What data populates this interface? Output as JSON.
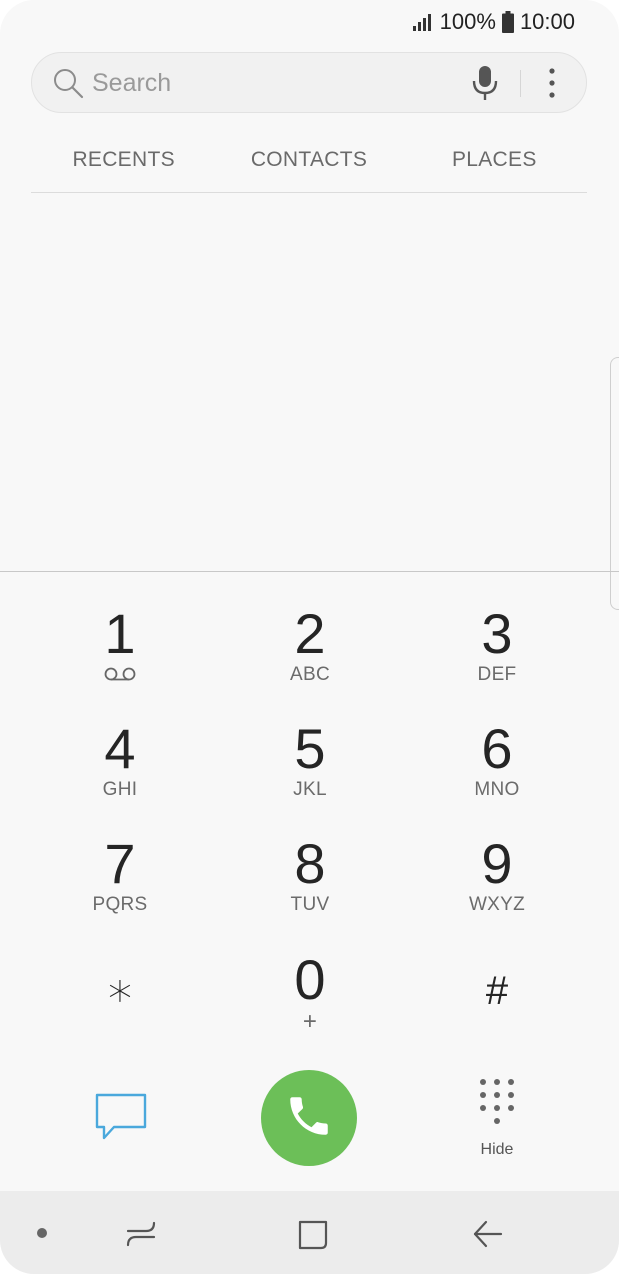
{
  "status": {
    "battery_percent": "100%",
    "time": "10:00"
  },
  "search": {
    "placeholder": "Search"
  },
  "tabs": [
    {
      "label": "RECENTS"
    },
    {
      "label": "CONTACTS"
    },
    {
      "label": "PLACES"
    }
  ],
  "dialpad": {
    "keys": [
      {
        "digit": "1",
        "letters": ""
      },
      {
        "digit": "2",
        "letters": "ABC"
      },
      {
        "digit": "3",
        "letters": "DEF"
      },
      {
        "digit": "4",
        "letters": "GHI"
      },
      {
        "digit": "5",
        "letters": "JKL"
      },
      {
        "digit": "6",
        "letters": "MNO"
      },
      {
        "digit": "7",
        "letters": "PQRS"
      },
      {
        "digit": "8",
        "letters": "TUV"
      },
      {
        "digit": "9",
        "letters": "WXYZ"
      },
      {
        "digit": "∗",
        "letters": ""
      },
      {
        "digit": "0",
        "letters": "+"
      },
      {
        "digit": "#",
        "letters": ""
      }
    ]
  },
  "actions": {
    "hide_label": "Hide"
  },
  "icons": {
    "signal": "signal-icon",
    "battery": "battery-icon",
    "search": "search-icon",
    "mic": "mic-icon",
    "more": "more-vertical-icon",
    "voicemail": "voicemail-icon",
    "message": "message-icon",
    "call": "phone-icon",
    "dialpad": "dialpad-icon",
    "recent_apps": "recent-apps-icon",
    "home": "home-icon",
    "back": "back-icon"
  },
  "colors": {
    "call_button": "#6cbf58",
    "message_icon": "#4aa8dc"
  }
}
